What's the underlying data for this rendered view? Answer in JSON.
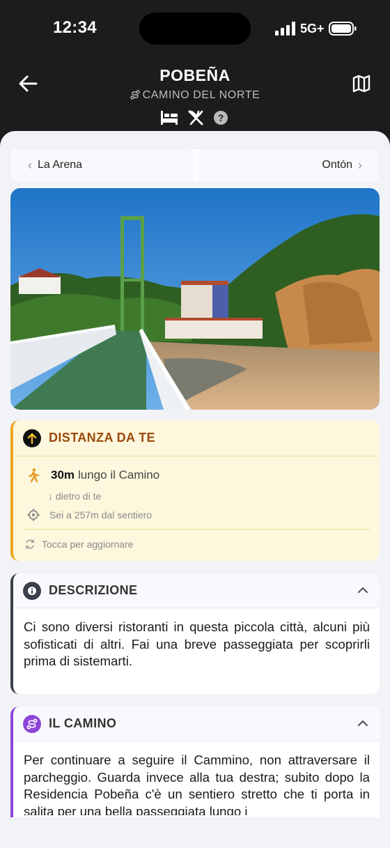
{
  "status": {
    "time": "12:34",
    "network": "5G+"
  },
  "header": {
    "title": "POBEÑA",
    "subtitle": "CAMINO DEL NORTE",
    "amenities": [
      "bed-icon",
      "restaurant-icon",
      "help-icon"
    ]
  },
  "nav": {
    "prev": "La Arena",
    "next": "Ontón"
  },
  "distance": {
    "title": "DISTANZA DA TE",
    "value": "30m",
    "suffix": "lungo il Camino",
    "direction": "↓ dietro di te",
    "from_trail": "Sei a 257m dal sentiero",
    "refresh": "Tocca per aggiornare"
  },
  "description": {
    "title": "DESCRIZIONE",
    "text": "Ci sono diversi ristoranti in questa piccola città, alcuni più sofisticati di altri. Fai una breve passeggiata per scoprirli prima di sistemarti."
  },
  "camino": {
    "title": "IL CAMINO",
    "text": "Per continuare a seguire il Cammino, non attraversare il parcheggio. Guarda invece alla tua destra; subito dopo la Residencia Pobeña c'è un sentiero stretto che ti porta in salita per una bella passeggiata lungo i"
  },
  "colors": {
    "distance_accent": "#efa51e",
    "description_accent": "#3b3f4a",
    "camino_accent": "#8e44d8"
  }
}
